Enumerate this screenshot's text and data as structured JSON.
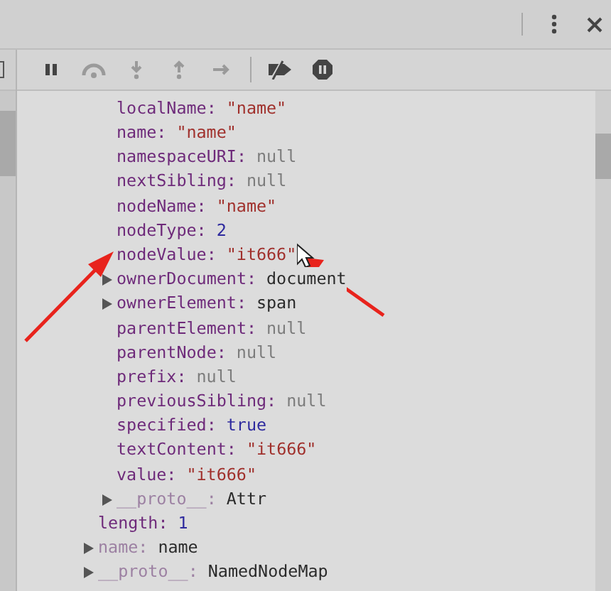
{
  "toolbar": {
    "buttons": [
      {
        "kind": "pause",
        "disabled": false
      },
      {
        "kind": "step-over",
        "disabled": true
      },
      {
        "kind": "step-into",
        "disabled": true
      },
      {
        "kind": "step-out",
        "disabled": true
      },
      {
        "kind": "step",
        "disabled": true
      },
      {
        "kind": "deactivate",
        "disabled": false
      },
      {
        "kind": "pause-exceptions",
        "disabled": false
      }
    ]
  },
  "tree": [
    {
      "children": [
        {
          "key": "localName:",
          "value": "\"name\"",
          "kind": "string",
          "expandable": false,
          "dim": false
        },
        {
          "key": "name:",
          "value": "\"name\"",
          "kind": "string",
          "expandable": false,
          "dim": false
        },
        {
          "key": "namespaceURI:",
          "value": "null",
          "kind": "null",
          "expandable": false,
          "dim": false
        },
        {
          "key": "nextSibling:",
          "value": "null",
          "kind": "null",
          "expandable": false,
          "dim": false
        },
        {
          "key": "nodeName:",
          "value": "\"name\"",
          "kind": "string",
          "expandable": false,
          "dim": false
        },
        {
          "key": "nodeType:",
          "value": "2",
          "kind": "number",
          "expandable": false,
          "dim": false
        },
        {
          "key": "nodeValue:",
          "value": "\"it666\"",
          "kind": "string",
          "expandable": false,
          "dim": false
        },
        {
          "key": "ownerDocument:",
          "value": "document",
          "kind": "object",
          "expandable": true,
          "dim": false
        },
        {
          "key": "ownerElement:",
          "value": "span",
          "kind": "object",
          "expandable": true,
          "dim": false
        },
        {
          "key": "parentElement:",
          "value": "null",
          "kind": "null",
          "expandable": false,
          "dim": false
        },
        {
          "key": "parentNode:",
          "value": "null",
          "kind": "null",
          "expandable": false,
          "dim": false
        },
        {
          "key": "prefix:",
          "value": "null",
          "kind": "null",
          "expandable": false,
          "dim": false
        },
        {
          "key": "previousSibling:",
          "value": "null",
          "kind": "null",
          "expandable": false,
          "dim": false
        },
        {
          "key": "specified:",
          "value": "true",
          "kind": "boolean",
          "expandable": false,
          "dim": false
        },
        {
          "key": "textContent:",
          "value": "\"it666\"",
          "kind": "string",
          "expandable": false,
          "dim": false
        },
        {
          "key": "value:",
          "value": "\"it666\"",
          "kind": "string",
          "expandable": false,
          "dim": false
        },
        {
          "key": "__proto__:",
          "value": "Attr",
          "kind": "object",
          "expandable": true,
          "dim": true
        }
      ]
    },
    {
      "key": "length:",
      "value": "1",
      "kind": "number",
      "expandable": false,
      "dim": false
    },
    {
      "key": "name:",
      "value": "name",
      "kind": "object",
      "expandable": true,
      "dim": true
    },
    {
      "key": "__proto__:",
      "value": "NamedNodeMap",
      "kind": "object",
      "expandable": true,
      "dim": true
    }
  ]
}
